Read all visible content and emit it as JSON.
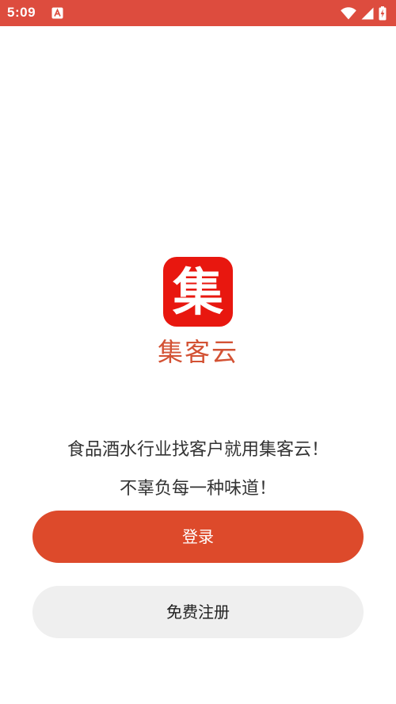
{
  "status_bar": {
    "time": "5:09",
    "color": "#dd4c3e",
    "icons": [
      "notification-a-icon",
      "wifi-icon",
      "signal-icon",
      "battery-charging-icon"
    ]
  },
  "brand": {
    "logo_char": "集",
    "logo_color": "#e8170f",
    "app_name": "集客云",
    "name_color": "#d35234"
  },
  "slogans": [
    "食品酒水行业找客户就用集客云！",
    "不辜负每一种味道！"
  ],
  "actions": {
    "login_label": "登录",
    "login_color": "#dd4a2b",
    "register_label": "免费注册",
    "register_color": "#efefef"
  }
}
